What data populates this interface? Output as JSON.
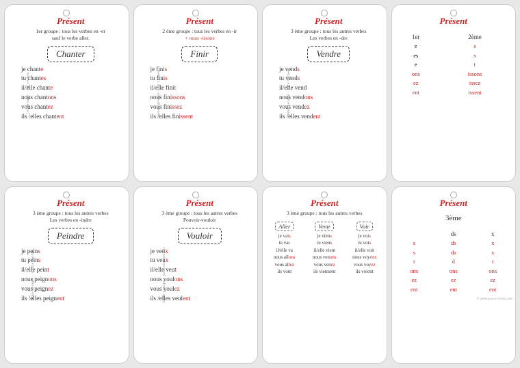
{
  "cards": [
    {
      "id": "card1",
      "title": "Présent",
      "subtitle": "1er groupe : tous les verbes en -er\nsauf le verbe aller.",
      "subtitle_red": "",
      "side_text": "1er groupe · -er verbes",
      "verb": "Chanter",
      "conjugation": [
        {
          "pronoun": "je chant",
          "ending": "e"
        },
        {
          "pronoun": "tu chant",
          "ending": "es"
        },
        {
          "pronoun": "il/elle chant",
          "ending": "e"
        },
        {
          "pronoun": "nous chant",
          "ending": "ons"
        },
        {
          "pronoun": "vous chant",
          "ending": "ez"
        },
        {
          "pronoun": "ils /elles chant",
          "ending": "ent"
        }
      ]
    },
    {
      "id": "card2",
      "title": "Présent",
      "subtitle": "2 ème groupe : tous les verbes en -ir",
      "subtitle_red": "+ nous -issons",
      "side_text": "2ème groupe · -ir verbes",
      "verb": "Finir",
      "conjugation": [
        {
          "pronoun": "je fin",
          "ending": "is"
        },
        {
          "pronoun": "tu fin",
          "ending": "is"
        },
        {
          "pronoun": "il/elle fin",
          "ending": "it"
        },
        {
          "pronoun": "nous fin",
          "ending": "issons"
        },
        {
          "pronoun": "vous fin",
          "ending": "issez"
        },
        {
          "pronoun": "ils /elles fin",
          "ending": "issent"
        }
      ]
    },
    {
      "id": "card3",
      "title": "Présent",
      "subtitle": "3 ème groupe : tous les autres verbes\nLes verbes en -dre",
      "subtitle_red": "",
      "side_text": "3ème groupe · -dre verbes",
      "verb": "Vendre",
      "conjugation": [
        {
          "pronoun": "je vend",
          "ending": "s"
        },
        {
          "pronoun": "tu vend",
          "ending": "s"
        },
        {
          "pronoun": "il/elle vend",
          "ending": ""
        },
        {
          "pronoun": "nous vend",
          "ending": "ons"
        },
        {
          "pronoun": "vous vend",
          "ending": "ez"
        },
        {
          "pronoun": "ils /elles vend",
          "ending": "ent"
        }
      ]
    },
    {
      "id": "card4",
      "title": "Présent",
      "type": "endings",
      "groups": [
        "1er",
        "2ème"
      ],
      "endings_1": [
        "e",
        "es",
        "e",
        "ons",
        "ez",
        "ent"
      ],
      "endings_2": [
        "s",
        "s",
        "t",
        "issons",
        "issez",
        "issent"
      ]
    },
    {
      "id": "card5",
      "title": "Présent",
      "subtitle": "3 ème groupe : tous les autres verbes\nLes verbes en -indre",
      "subtitle_red": "",
      "side_text": "3ème groupe · -indre verbes",
      "verb": "Peindre",
      "conjugation": [
        {
          "pronoun": "je pein",
          "ending": "s"
        },
        {
          "pronoun": "tu pein",
          "ending": "s"
        },
        {
          "pronoun": "il/elle pein",
          "ending": "t"
        },
        {
          "pronoun": "nous peign",
          "ending": "ons"
        },
        {
          "pronoun": "vous peign",
          "ending": "ez"
        },
        {
          "pronoun": "ils /elles peign",
          "ending": "ent"
        }
      ]
    },
    {
      "id": "card6",
      "title": "Présent",
      "subtitle": "3 ème groupe : tous les autres verbes\nPouvoir-vouloir",
      "subtitle_red": "",
      "side_text": "3ème groupe · pouvoir-vouloir",
      "verb": "Vouloir",
      "conjugation": [
        {
          "pronoun": "je veu",
          "ending": "x"
        },
        {
          "pronoun": "tu veu",
          "ending": "x"
        },
        {
          "pronoun": "il/elle veu",
          "ending": "t"
        },
        {
          "pronoun": "nous voul",
          "ending": "ons"
        },
        {
          "pronoun": "vous voul",
          "ending": "ez"
        },
        {
          "pronoun": "ils /elles veul",
          "ending": "ent"
        }
      ]
    },
    {
      "id": "card7",
      "title": "Présent",
      "subtitle": "3 ème groupe : tous les autres verbes",
      "type": "multi",
      "verbs": [
        "Aller",
        "Venir",
        "Voir"
      ],
      "conjugations": [
        [
          "je vais",
          "tu vas",
          "il/elle va",
          "nous allons",
          "vous allez",
          "ils vont"
        ],
        [
          "je viens",
          "tu viens",
          "il/elle vient",
          "nous venons",
          "vous venez",
          "ils viennent"
        ],
        [
          "je vois",
          "tu vois",
          "il/elle voit",
          "nous voyons",
          "vous voyez",
          "ils voient"
        ]
      ],
      "red_endings": [
        [
          "s",
          "s",
          "",
          "ons",
          "ez",
          "nt"
        ],
        [
          "s",
          "s",
          "t",
          "ons",
          "ez",
          "ent"
        ],
        [
          "s",
          "s",
          "t",
          "ons",
          "ez",
          "ent"
        ]
      ]
    },
    {
      "id": "card8",
      "title": "Présent",
      "type": "endings3",
      "group_label": "3ème",
      "endings": [
        {
          "left": "s",
          "right": "ds"
        },
        {
          "left": "s",
          "right": "ds"
        },
        {
          "left": "t",
          "right": "d"
        },
        {
          "left": "ons",
          "right": "ons"
        },
        {
          "left": "ez",
          "right": "ez"
        },
        {
          "left": "ent",
          "right": "ent"
        }
      ],
      "col3": [
        "x",
        "x",
        "t",
        "ons",
        "ez",
        "ent"
      ]
    }
  ],
  "watermark": "© pellerossa.e-stretto.com"
}
